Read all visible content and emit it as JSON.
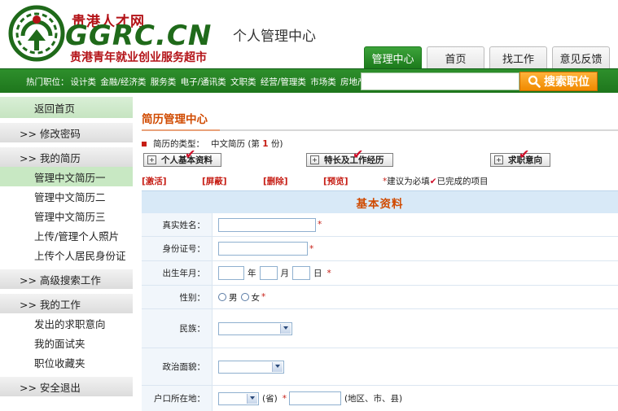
{
  "header": {
    "logo_cn": "贵港人才网",
    "logo_en": "GGRC",
    "logo_en_suffix": ".CN",
    "slogan": "贵港青年就业创业服务超市",
    "page_title": "个人管理中心",
    "tabs": [
      {
        "label": "管理中心",
        "active": true
      },
      {
        "label": "首页",
        "active": false
      },
      {
        "label": "找工作",
        "active": false
      },
      {
        "label": "意见反馈",
        "active": false
      }
    ]
  },
  "hotbar": {
    "prefix": "热门职位：",
    "items": [
      "设计类",
      "金融/经济类",
      "服务类",
      "电子/通讯类",
      "文职类",
      "经营/管理类",
      "市场类",
      "房地产"
    ],
    "search_placeholder": "",
    "search_button": "搜索职位"
  },
  "sidebar": {
    "back": "返回首页",
    "change_password": ">> 修改密码",
    "my_resume": ">> 我的简历",
    "resume_items": [
      "管理中文简历一",
      "管理中文简历二",
      "管理中文简历三",
      "上传/管理个人照片",
      "上传个人居民身份证"
    ],
    "advanced_search": ">> 高级搜索工作",
    "my_work": ">> 我的工作",
    "work_items": [
      "发出的求职意向",
      "我的面试夹",
      "职位收藏夹"
    ],
    "logout": ">> 安全退出"
  },
  "main": {
    "title": "简历管理中心",
    "resume_type_label": "简历的类型：",
    "resume_type_value": "中文简历 (第",
    "resume_type_num": "1",
    "resume_type_suffix": "份)",
    "steps": [
      "个人基本资料",
      "特长及工作经历",
      "求职意向"
    ],
    "actions": [
      "[激活]",
      "[屏蔽]",
      "[删除]",
      "[预览]"
    ],
    "note_star": "*",
    "note_text_1": "建议为必填",
    "note_check": "✔",
    "note_text_2": "已完成的项目"
  },
  "form": {
    "section_title": "基本资料",
    "name_label": "真实姓名：",
    "id_label": "身份证号：",
    "birth_label": "出生年月：",
    "year": "年",
    "month": "月",
    "day": "日",
    "gender_label": "性别：",
    "male": "男",
    "female": "女",
    "nation_label": "民族：",
    "politics_label": "政治面貌：",
    "hukou_label": "户口所在地：",
    "province": "(省)",
    "region_hint": "(地区、市、县)",
    "required_mark": "*"
  },
  "colors": {
    "brand_green": "#1e761c",
    "accent_orange": "#f08a00",
    "title_orange": "#d04a00",
    "required_red": "#c61d14",
    "form_header_bg": "#d8e9f7"
  }
}
